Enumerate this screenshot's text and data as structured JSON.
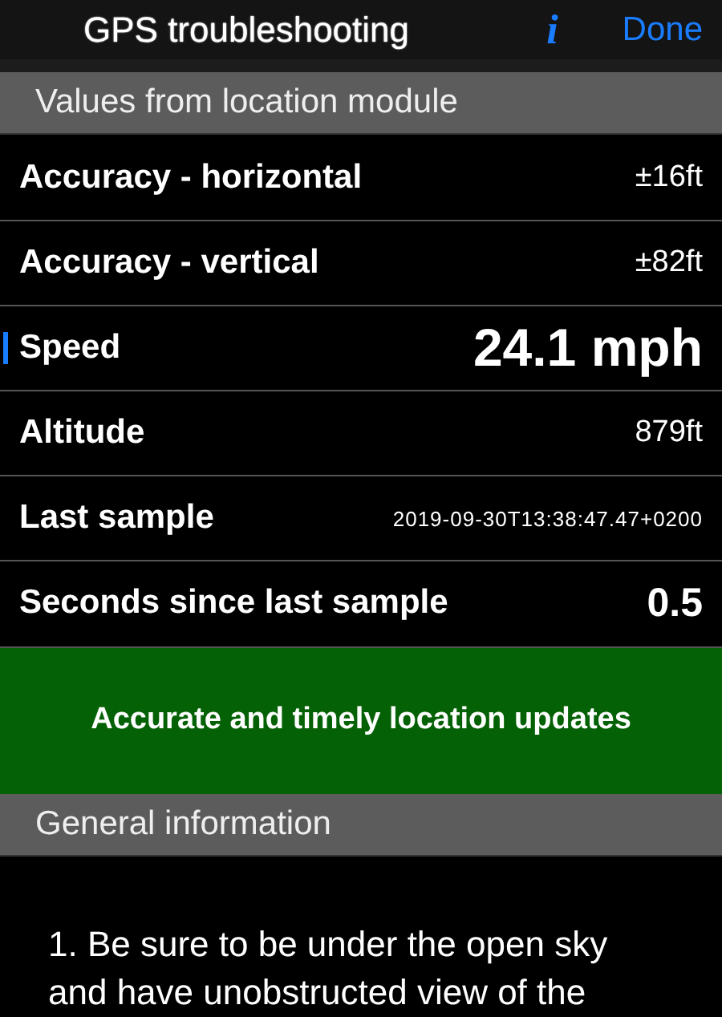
{
  "nav_bar": {
    "title": "GPS troubleshooting",
    "info_button": "i",
    "done_button": "Done"
  },
  "sections": [
    {
      "header": "Values from location module",
      "rows": [
        {
          "label": "Accuracy - horizontal",
          "value": "±16ft",
          "kind": "normal",
          "highlighted": false
        },
        {
          "label": "Accuracy - vertical",
          "value": "±82ft",
          "kind": "normal",
          "highlighted": false
        },
        {
          "label": "Speed",
          "value": "24.1 mph",
          "kind": "large",
          "highlighted": true
        },
        {
          "label": "Altitude",
          "value": "879ft",
          "kind": "normal",
          "highlighted": false
        },
        {
          "label": "Last sample",
          "value": "2019-09-30T13:38:47.47+0200",
          "kind": "small",
          "highlighted": false
        },
        {
          "label": "Seconds since last sample",
          "value": "0.5",
          "kind": "medium",
          "highlighted": false
        }
      ]
    }
  ],
  "status_banner": {
    "text": "Accurate and timely location updates"
  },
  "general": {
    "header": "General information",
    "paragraph": "1. Be sure to be under the open sky and have unobstructed view of the"
  }
}
